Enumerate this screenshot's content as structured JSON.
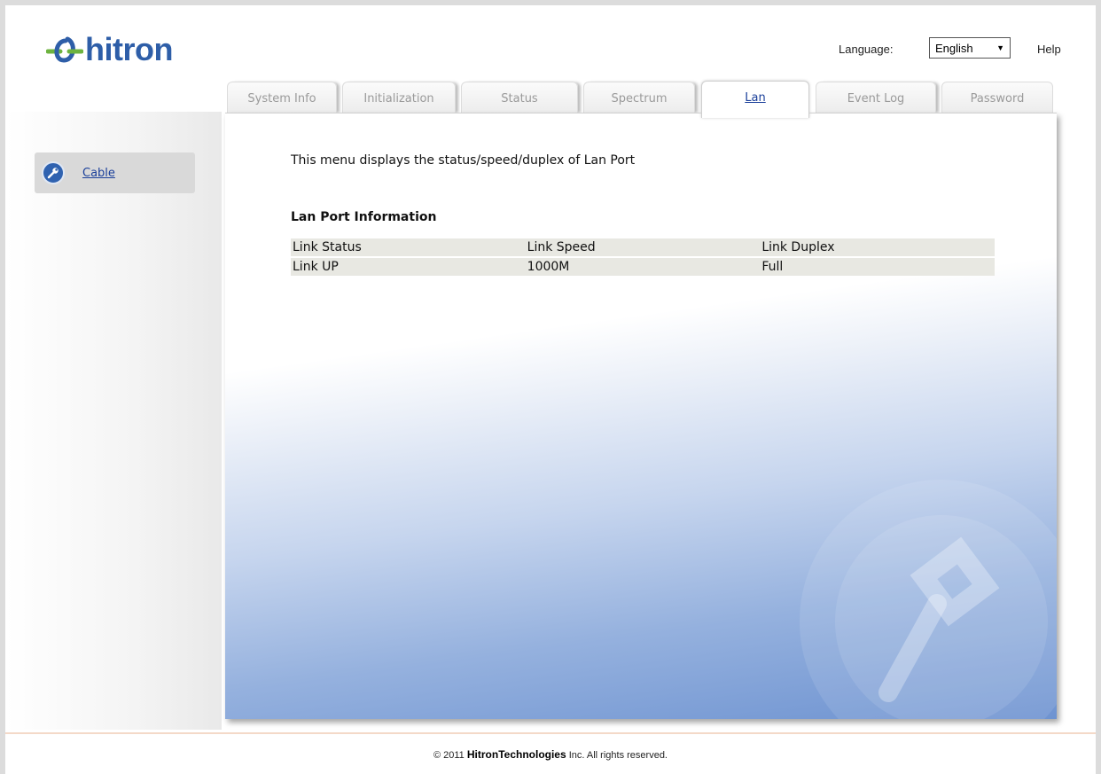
{
  "header": {
    "logo_text": "hitron",
    "language_label": "Language:",
    "language_value": "English",
    "help_label": "Help"
  },
  "tabs": [
    {
      "label": "System Info",
      "active": false
    },
    {
      "label": "Initialization",
      "active": false
    },
    {
      "label": "Status",
      "active": false
    },
    {
      "label": "Spectrum",
      "active": false
    },
    {
      "label": "Lan",
      "active": true
    },
    {
      "label": "Event Log",
      "active": false
    },
    {
      "label": "Password",
      "active": false
    }
  ],
  "sidebar": {
    "items": [
      {
        "label": "Cable",
        "icon": "wrench-icon"
      }
    ]
  },
  "main": {
    "intro": "This menu displays the status/speed/duplex of Lan Port",
    "section_title": "Lan Port Information",
    "table": {
      "headers": [
        "Link Status",
        "Link Speed",
        "Link Duplex"
      ],
      "rows": [
        [
          "Link UP",
          "1000M",
          "Full"
        ]
      ]
    }
  },
  "footer": {
    "prefix": "© 2011",
    "brand": "HitronTechnologies",
    "suffix": "Inc.  All rights reserved."
  },
  "colors": {
    "brand_blue": "#2e5ea8",
    "link_blue": "#1a3f9a",
    "accent_green": "#6db33f"
  }
}
